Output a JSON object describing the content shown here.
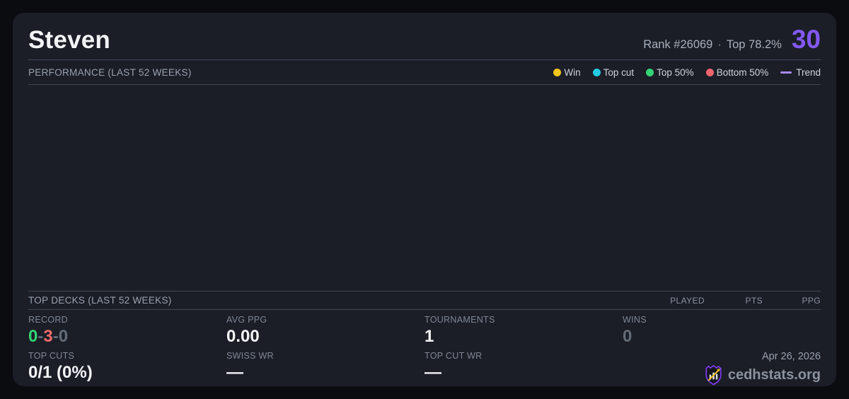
{
  "player": {
    "name": "Steven",
    "rank_text": "Rank #26069",
    "separator": "·",
    "top_percent": "Top 78.2%",
    "score": "30",
    "score_color": "#8358f0"
  },
  "performance": {
    "title": "PERFORMANCE (LAST 52 WEEKS)",
    "legend": [
      {
        "label": "Win",
        "color": "#f5c51d",
        "swatch": "dot"
      },
      {
        "label": "Top cut",
        "color": "#25cbe3",
        "swatch": "dot"
      },
      {
        "label": "Top 50%",
        "color": "#33d474",
        "swatch": "dot"
      },
      {
        "label": "Bottom 50%",
        "color": "#f0646e",
        "swatch": "dot"
      },
      {
        "label": "Trend",
        "color": "#a78bfa",
        "swatch": "line"
      }
    ]
  },
  "chart_data": {
    "type": "scatter",
    "title": "PERFORMANCE (LAST 52 WEEKS)",
    "points": [],
    "legend_entries": [
      "Win",
      "Top cut",
      "Top 50%",
      "Bottom 50%",
      "Trend"
    ],
    "note": "chart area is empty - no events plotted"
  },
  "top_decks": {
    "title": "TOP DECKS (LAST 52 WEEKS)",
    "columns": [
      "PLAYED",
      "PTS",
      "PPG"
    ],
    "rows": []
  },
  "stats": {
    "record": {
      "label": "RECORD",
      "wins": "0",
      "losses": "3",
      "draws": "0",
      "separator": "-"
    },
    "avg_ppg": {
      "label": "AVG PPG",
      "value": "0.00"
    },
    "tournaments": {
      "label": "TOURNAMENTS",
      "value": "1"
    },
    "wins": {
      "label": "WINS",
      "value": "0"
    },
    "top_cuts": {
      "label": "TOP CUTS",
      "value": "0/1 (0%)"
    },
    "swiss_wr": {
      "label": "SWISS WR",
      "value": "—"
    },
    "top_cut_wr": {
      "label": "TOP CUT WR",
      "value": "—"
    }
  },
  "footer": {
    "date": "Apr 26, 2026",
    "brand": "cedhstats.org"
  },
  "colors": {
    "card_bg": "#1b1e27",
    "page_bg": "#0b0c10",
    "accent_purple": "#8358f0",
    "win_green": "#33d474",
    "loss_red": "#ef6a6a",
    "muted_gray": "#646b78"
  }
}
